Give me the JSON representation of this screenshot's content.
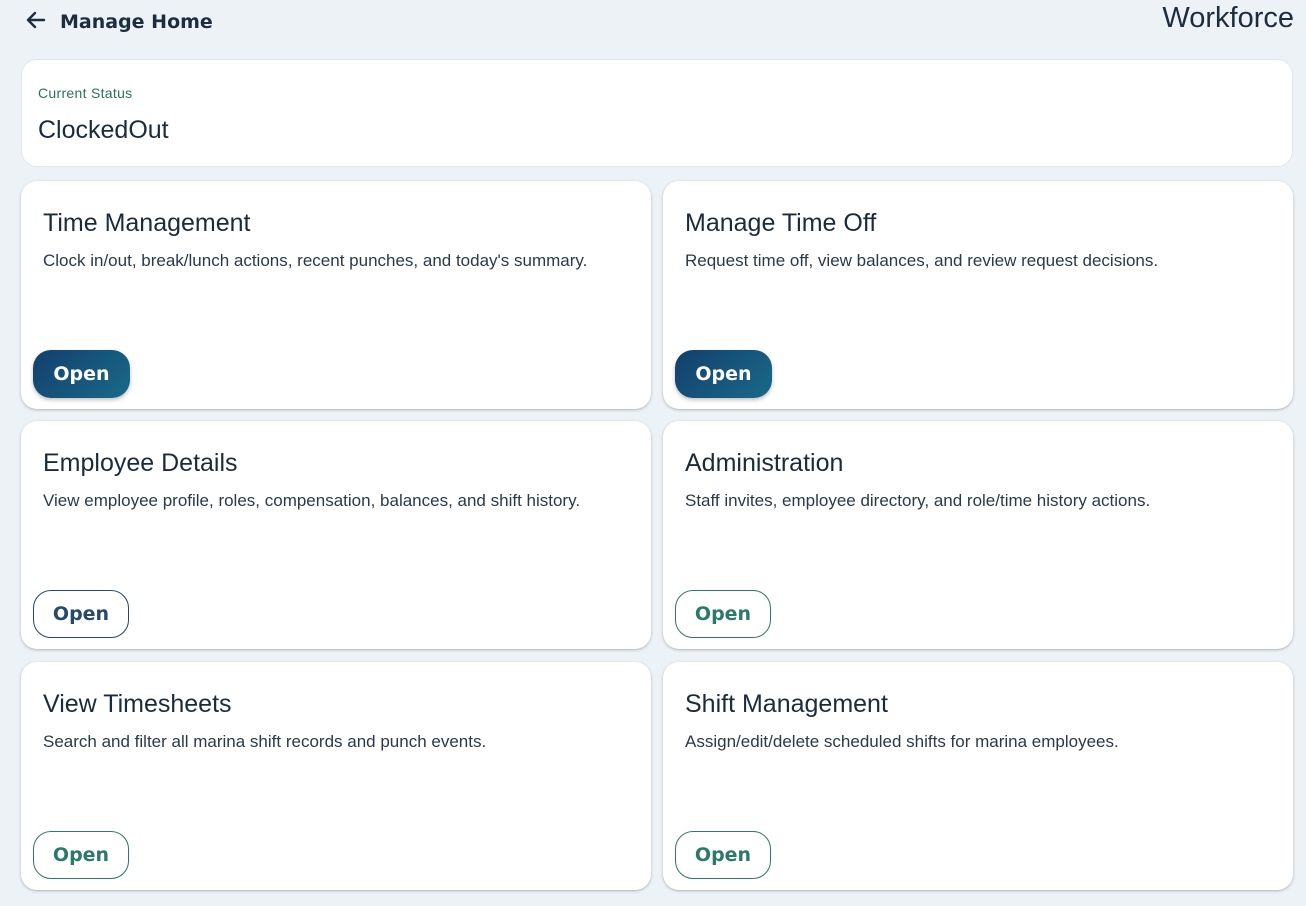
{
  "header": {
    "back_label": "Manage Home",
    "title": "Workforce"
  },
  "status": {
    "label": "Current Status",
    "value": "ClockedOut"
  },
  "cards": [
    {
      "title": "Time Management",
      "description": "Clock in/out, break/lunch actions, recent punches, and today's summary.",
      "button": "Open"
    },
    {
      "title": "Manage Time Off",
      "description": "Request time off, view balances, and review request decisions.",
      "button": "Open"
    },
    {
      "title": "Employee Details",
      "description": "View employee profile, roles, compensation, balances, and shift history.",
      "button": "Open"
    },
    {
      "title": "Administration",
      "description": "Staff invites, employee directory, and role/time history actions.",
      "button": "Open"
    },
    {
      "title": "View Timesheets",
      "description": "Search and filter all marina shift records and punch events.",
      "button": "Open"
    },
    {
      "title": "Shift Management",
      "description": "Assign/edit/delete scheduled shifts for marina employees.",
      "button": "Open"
    }
  ],
  "colors": {
    "background": "#edf2f6",
    "primary_gradient_start": "#123f6b",
    "primary_gradient_end": "#1a6a8a",
    "outline_navy": "#24496a",
    "outline_teal": "#2b7a69",
    "status_label": "#2f6f5e"
  },
  "icons": {
    "back": "arrow-left-icon"
  }
}
